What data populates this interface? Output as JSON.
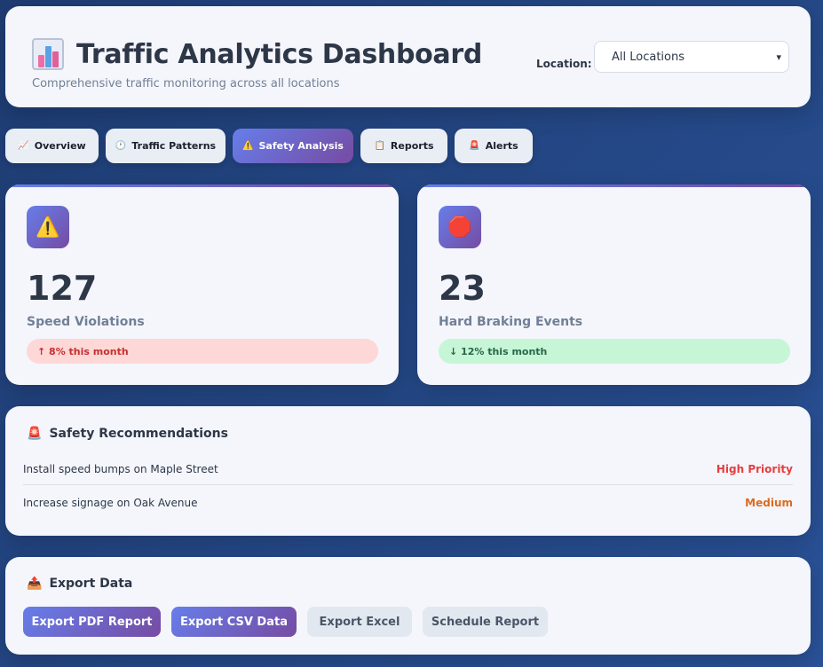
{
  "header": {
    "title": "Traffic Analytics Dashboard",
    "subtitle": "Comprehensive traffic monitoring across all locations",
    "title_icon": "bar-chart-icon",
    "location_label": "Location:",
    "location_selected": "All Locations"
  },
  "tabs": [
    {
      "label": "Overview",
      "icon": "📈"
    },
    {
      "label": "Traffic Patterns",
      "icon": "🕐"
    },
    {
      "label": "Safety Analysis",
      "icon": "⚠️",
      "active": true
    },
    {
      "label": "Reports",
      "icon": "📋"
    },
    {
      "label": "Alerts",
      "icon": "🚨"
    }
  ],
  "stats": [
    {
      "icon": "⚠️",
      "value": "127",
      "label": "Speed Violations",
      "trend": "↑ 8% this month",
      "trend_dir": "up"
    },
    {
      "icon": "🛑",
      "value": "23",
      "label": "Hard Braking Events",
      "trend": "↓ 12% this month",
      "trend_dir": "down"
    }
  ],
  "recommendations": {
    "title": "Safety Recommendations",
    "icon": "🚨",
    "items": [
      {
        "text": "Install speed bumps on Maple Street",
        "priority": "High Priority",
        "color": "#e53e3e"
      },
      {
        "text": "Increase signage on Oak Avenue",
        "priority": "Medium",
        "color": "#dd6b20"
      }
    ]
  },
  "export": {
    "title": "Export Data",
    "icon": "📤",
    "buttons": [
      "Export PDF Report",
      "Export CSV Data",
      "Export Excel",
      "Schedule Report"
    ]
  },
  "colors": {
    "accent_start": "#667eea",
    "accent_end": "#764ba2",
    "background": "#1e3c72"
  }
}
